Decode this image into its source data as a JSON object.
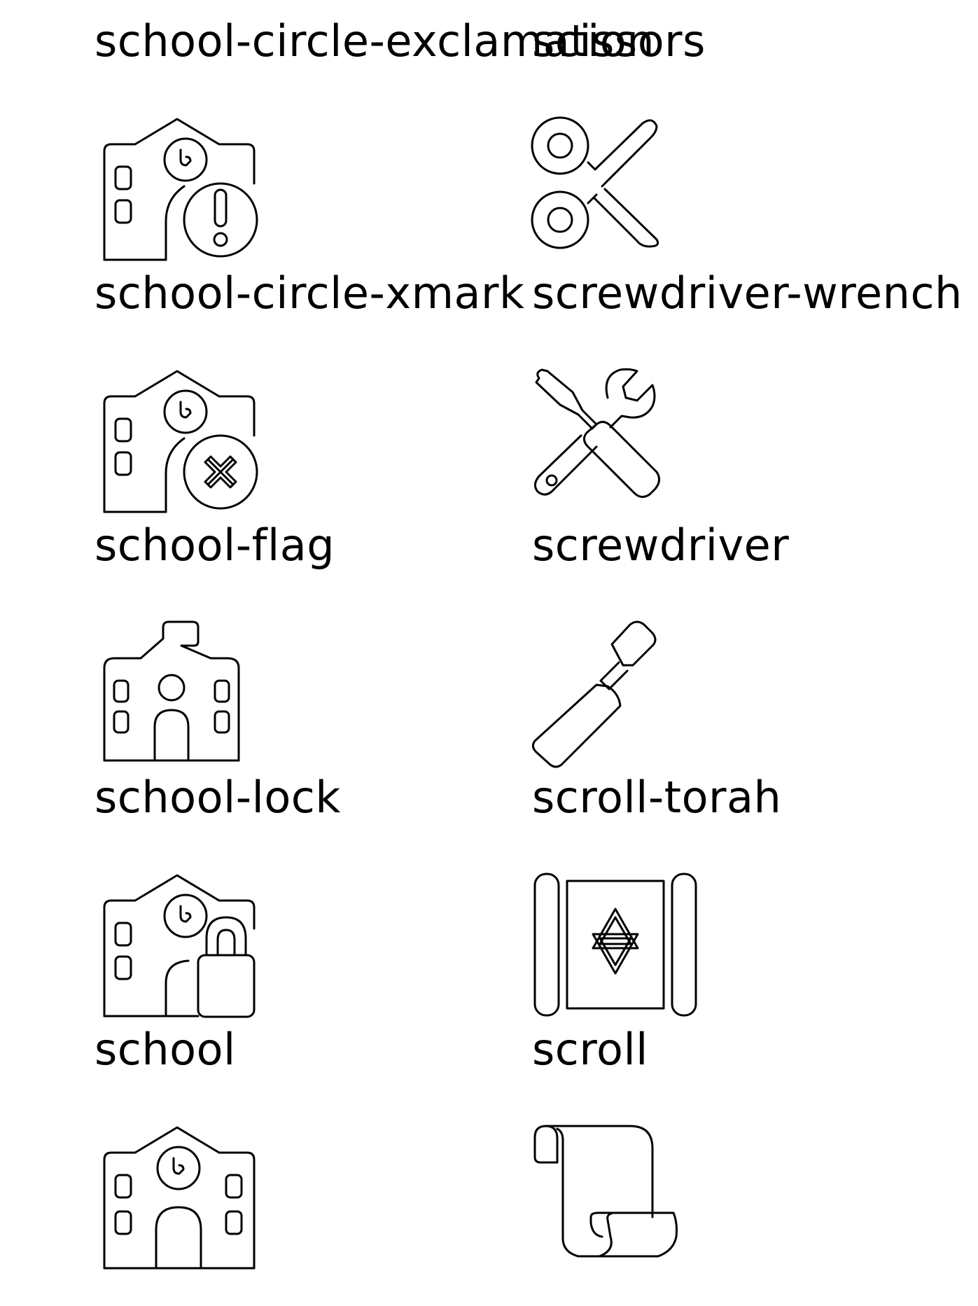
{
  "icons": [
    {
      "label": "school-circle-exclamation",
      "icon": "school-circle-exclamation-icon"
    },
    {
      "label": "scissors",
      "icon": "scissors-icon"
    },
    {
      "label": "school-circle-xmark",
      "icon": "school-circle-xmark-icon"
    },
    {
      "label": "screwdriver-wrench",
      "icon": "screwdriver-wrench-icon"
    },
    {
      "label": "school-flag",
      "icon": "school-flag-icon"
    },
    {
      "label": "screwdriver",
      "icon": "screwdriver-icon"
    },
    {
      "label": "school-lock",
      "icon": "school-lock-icon"
    },
    {
      "label": "scroll-torah",
      "icon": "scroll-torah-icon"
    },
    {
      "label": "school",
      "icon": "school-icon"
    },
    {
      "label": "scroll",
      "icon": "scroll-icon"
    }
  ]
}
